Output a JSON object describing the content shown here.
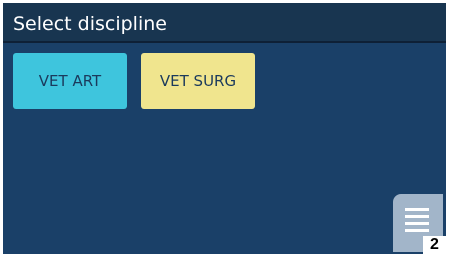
{
  "header": {
    "title": "Select discipline"
  },
  "disciplines": [
    {
      "label": "VET ART",
      "color": "#3ec5dd"
    },
    {
      "label": "VET SURG",
      "color": "#f0e58e"
    }
  ],
  "menu_button": {
    "icon": "hamburger-menu-icon"
  },
  "callout_badge": "2",
  "colors": {
    "background": "#1a4068",
    "header": "#183550",
    "menu_button": "#a2b5c9"
  }
}
